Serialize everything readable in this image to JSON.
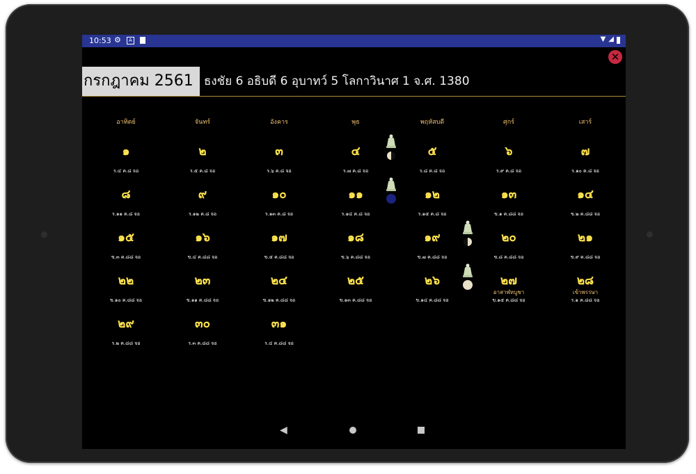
{
  "status_bar": {
    "time": "10:53",
    "left_icons": [
      "gear-icon",
      "a-notification-icon",
      "sd-card-icon"
    ],
    "right_icons": [
      "wifi-icon",
      "signal-icon",
      "battery-icon"
    ]
  },
  "close_button": "✕",
  "title": {
    "month_year": "กรกฎาคม 2561",
    "era_info": "ธงชัย 6  อธิบดี 6  อุบาทว์ 5  โลกาวินาศ 1  จ.ศ. 1380"
  },
  "weekdays": [
    "อาทิตย์",
    "จันทร์",
    "อังคาร",
    "พุธ",
    "พฤหัสบดี",
    "ศุกร์",
    "เสาร์"
  ],
  "weeks": [
    [
      {
        "num": "๑",
        "sub": "ร.๔ ค.๘ จอ"
      },
      {
        "num": "๒",
        "sub": "ร.๕ ค.๘ จอ"
      },
      {
        "num": "๓",
        "sub": "ร.๖ ค.๘ จอ"
      },
      {
        "num": "๔",
        "sub": "ร.๗ ค.๘ จอ"
      },
      {
        "num": "๕",
        "sub": "ร.๘ ค.๘ จอ",
        "moon": "first-quarter"
      },
      {
        "num": "๖",
        "sub": "ร.๙ ค.๘ จอ"
      },
      {
        "num": "๗",
        "sub": "ร.๑๐ ค.๘ จอ"
      }
    ],
    [
      {
        "num": "๘",
        "sub": "ร.๑๑ ค.๘ จอ"
      },
      {
        "num": "๙",
        "sub": "ร.๑๒ ค.๘ จอ"
      },
      {
        "num": "๑๐",
        "sub": "ร.๑๓ ค.๘ จอ"
      },
      {
        "num": "๑๑",
        "sub": "ร.๑๔ ค.๘ จอ"
      },
      {
        "num": "๑๒",
        "sub": "ร.๑๕ ค.๘ จอ",
        "moon": "new"
      },
      {
        "num": "๑๓",
        "sub": "ข.๑ ค.๘๘ จอ"
      },
      {
        "num": "๑๔",
        "sub": "ข.๒ ค.๘๘ จอ"
      }
    ],
    [
      {
        "num": "๑๕",
        "sub": "ข.๓ ค.๘๘ จอ"
      },
      {
        "num": "๑๖",
        "sub": "ข.๔ ค.๘๘ จอ"
      },
      {
        "num": "๑๗",
        "sub": "ข.๕ ค.๘๘ จอ"
      },
      {
        "num": "๑๘",
        "sub": "ข.๖ ค.๘๘ จอ"
      },
      {
        "num": "๑๙",
        "sub": "ข.๗ ค.๘๘ จอ"
      },
      {
        "num": "๒๐",
        "sub": "ข.๘ ค.๘๘ จอ",
        "moon": "last-quarter"
      },
      {
        "num": "๒๑",
        "sub": "ข.๙ ค.๘๘ จอ"
      }
    ],
    [
      {
        "num": "๒๒",
        "sub": "ข.๑๐ ค.๘๘ จอ"
      },
      {
        "num": "๒๓",
        "sub": "ข.๑๑ ค.๘๘ จอ"
      },
      {
        "num": "๒๔",
        "sub": "ข.๑๒ ค.๘๘ จอ"
      },
      {
        "num": "๒๕",
        "sub": "ข.๑๓ ค.๘๘ จอ"
      },
      {
        "num": "๒๖",
        "sub": "ข.๑๔ ค.๘๘ จอ"
      },
      {
        "num": "๒๗",
        "sub": "ข.๑๕ ค.๘๘ จอ",
        "festival": "อาสาฬหบูชา",
        "moon": "full"
      },
      {
        "num": "๒๘",
        "sub": "ร.๑ ค.๘๘ จอ",
        "festival": "เข้าพรรษา"
      }
    ],
    [
      {
        "num": "๒๙",
        "sub": "ร.๒ ค.๘๘ จอ"
      },
      {
        "num": "๓๐",
        "sub": "ร.๓ ค.๘๘ จอ"
      },
      {
        "num": "๓๑",
        "sub": "ร.๔ ค.๘๘ จอ"
      }
    ]
  ],
  "nav_bar": {
    "back": "◀",
    "icons": [
      "back-icon",
      "home-icon",
      "recents-icon"
    ]
  },
  "colors": {
    "status_bar": "#283593",
    "day_number": "#ffe34d",
    "weekday_label": "#f0c070",
    "close_button": "#c62840",
    "background": "#000000"
  }
}
